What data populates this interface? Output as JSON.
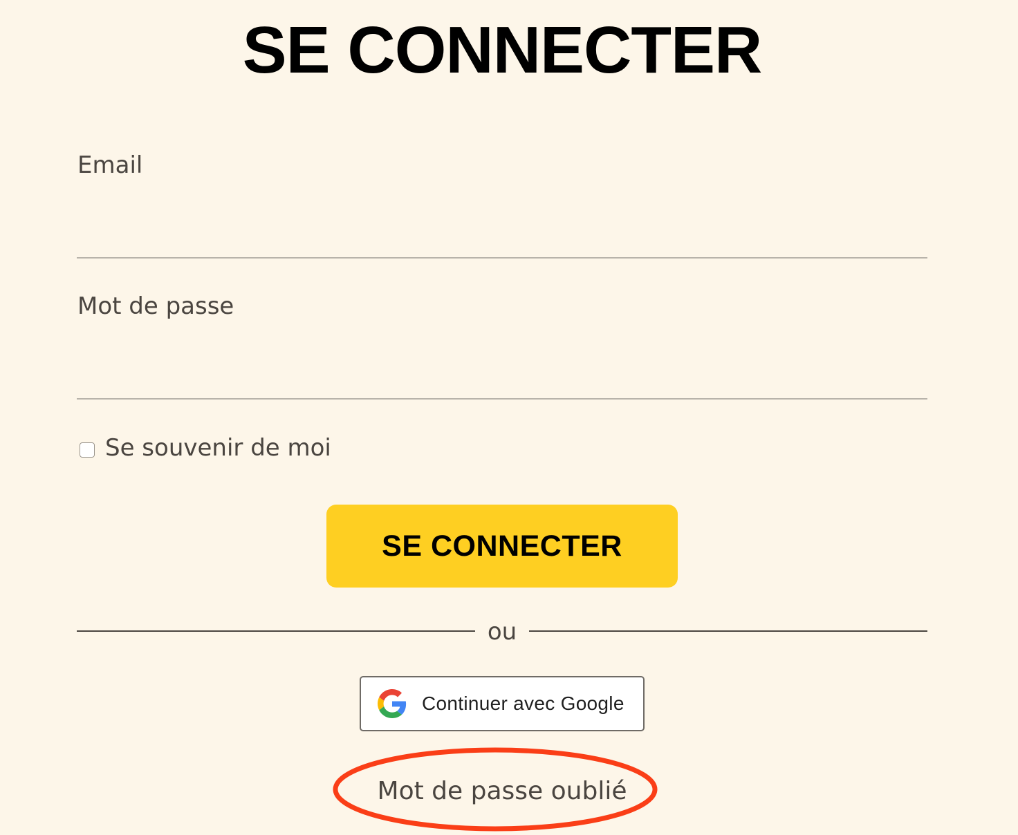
{
  "page": {
    "title": "SE CONNECTER"
  },
  "form": {
    "email": {
      "label": "Email",
      "value": "",
      "placeholder": ""
    },
    "password": {
      "label": "Mot de passe",
      "value": "",
      "placeholder": ""
    },
    "remember_me": {
      "label": "Se souvenir de moi",
      "checked": false
    },
    "submit_label": "SE CONNECTER",
    "divider_text": "ou",
    "google_label": "Continuer avec Google",
    "forgot_password_label": "Mot de passe oublié"
  },
  "icons": {
    "google": "google-g-logo"
  },
  "colors": {
    "background": "#fdf6e9",
    "primary_button": "#fecf22",
    "annotation": "#fa3e17",
    "text": "#4a4540"
  },
  "annotation": {
    "type": "ellipse",
    "target": "forgot-password-link"
  }
}
